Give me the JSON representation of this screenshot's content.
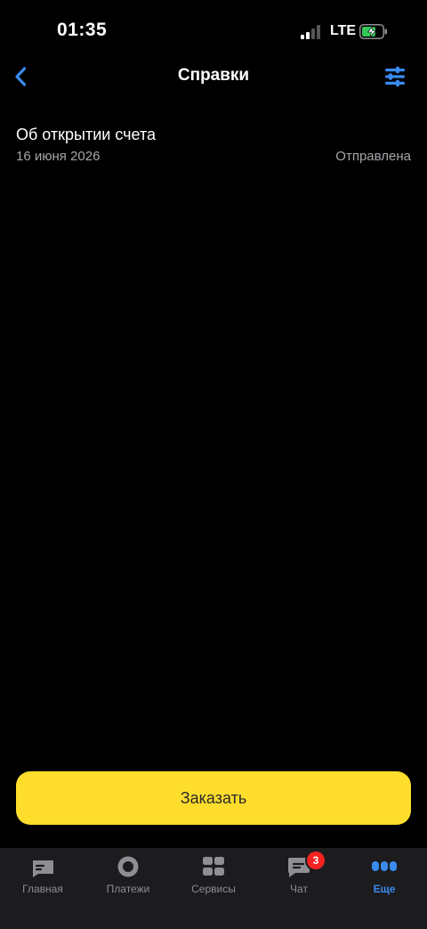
{
  "status_bar": {
    "time": "01:35",
    "network": "LTE"
  },
  "header": {
    "title": "Справки"
  },
  "documents": [
    {
      "title": "Об открытии счета",
      "date": "16 июня 2026",
      "status": "Отправлена"
    }
  ],
  "actions": {
    "order_label": "Заказать"
  },
  "tab_bar": {
    "items": [
      {
        "label": "Главная",
        "icon": "home-card-icon"
      },
      {
        "label": "Платежи",
        "icon": "payments-circle-icon"
      },
      {
        "label": "Сервисы",
        "icon": "services-grid-icon"
      },
      {
        "label": "Чат",
        "icon": "chat-bubble-icon",
        "badge": "3"
      },
      {
        "label": "Еще",
        "icon": "more-dots-icon",
        "active": true
      }
    ]
  },
  "colors": {
    "background": "#000000",
    "accent_blue": "#3a8bf0",
    "primary_button": "#ffdd2d",
    "secondary_text": "#a5a5ab",
    "tab_bar_bg": "#1c1c1e",
    "badge": "#f52222"
  }
}
